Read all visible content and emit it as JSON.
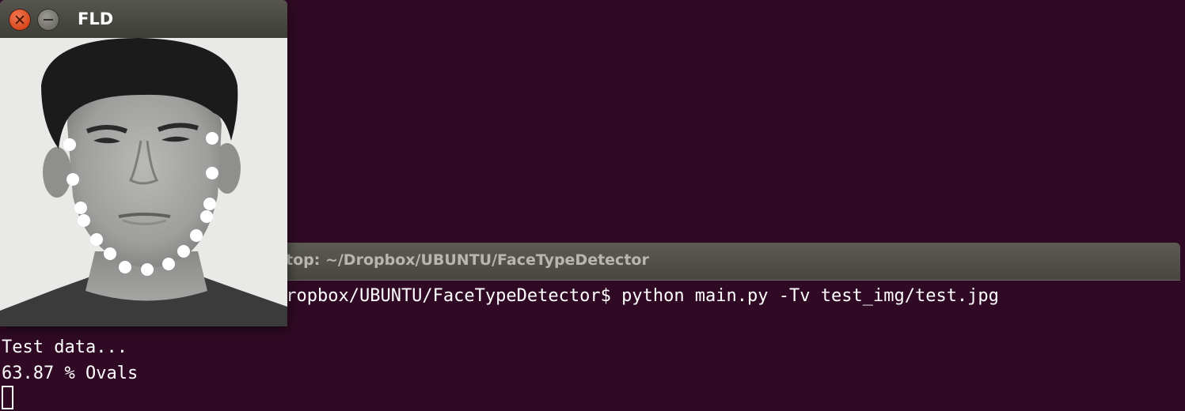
{
  "fld_window": {
    "title": "FLD",
    "close_icon": "close-icon",
    "minimize_icon": "minimize-icon"
  },
  "terminal": {
    "title": "top: ~/Dropbox/UBUNTU/FaceTypeDetector",
    "command_line": "Dropbox/UBUNTU/FaceTypeDetector$ python main.py -Tv test_img/test.jpg",
    "output": [
      "Test data...",
      "63.87 % Ovals"
    ]
  },
  "colors": {
    "terminal_background": "#300a24",
    "terminal_text": "#ffffff",
    "close_button": "#e05424",
    "landmark_dot": "#ffffff"
  }
}
